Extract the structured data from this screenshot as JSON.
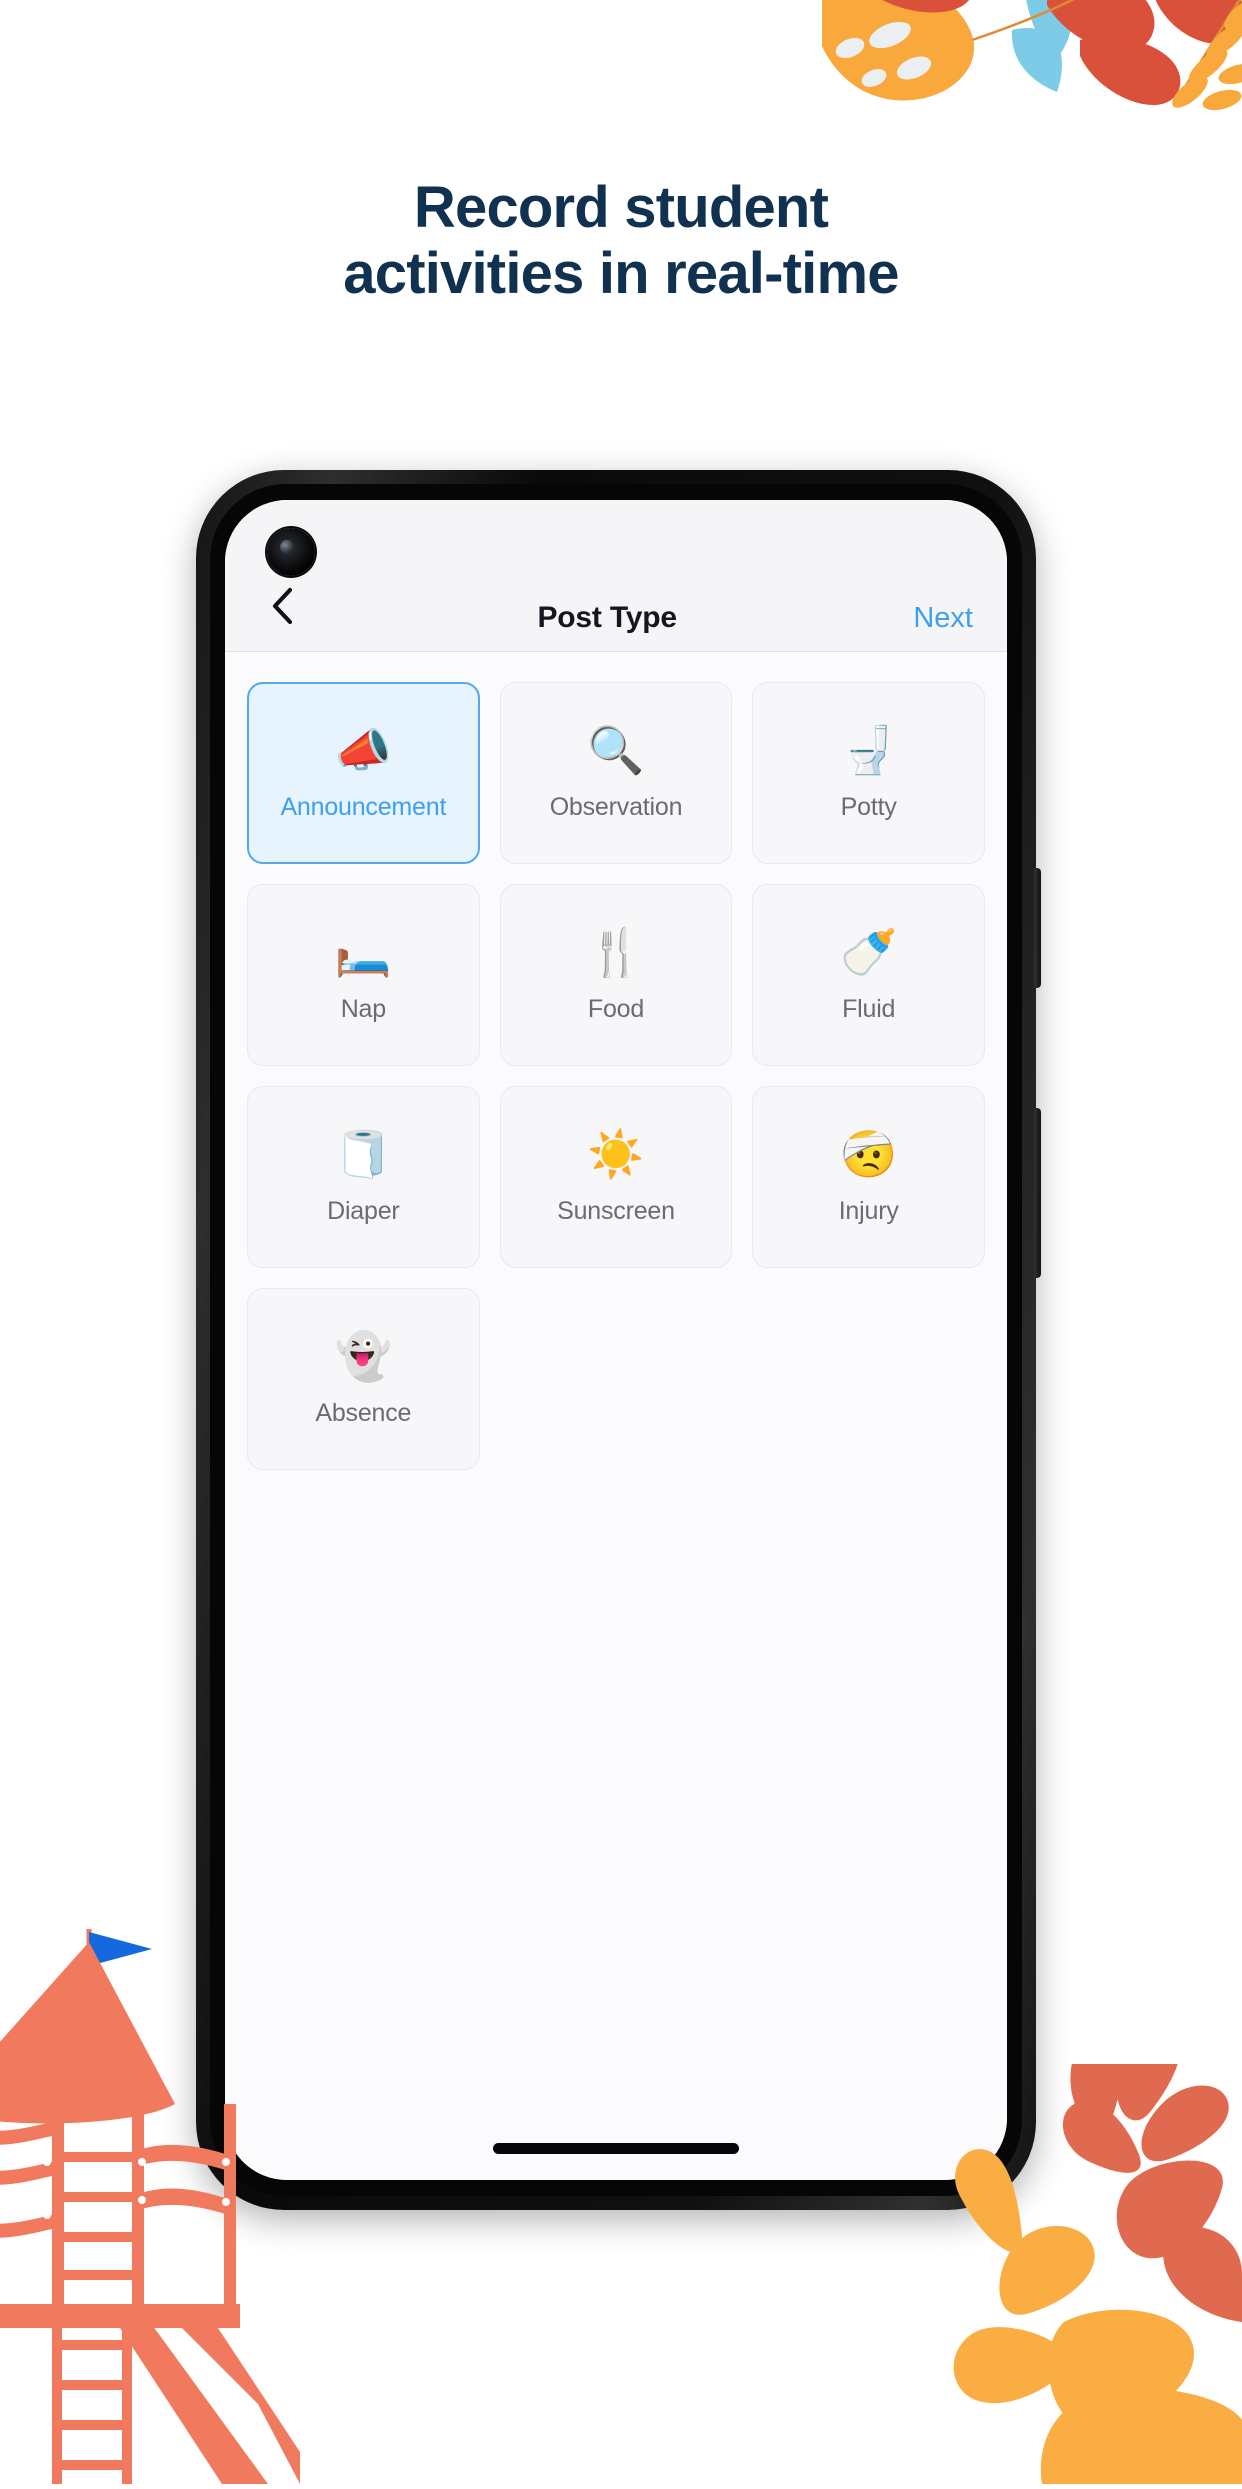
{
  "page": {
    "background_color": "#ffffff",
    "headline_color": "#10314f",
    "headline_line1": "Record student",
    "headline_line2": "activities in real-time"
  },
  "decor": {
    "top_right_name": "tropical-leaves-illustration",
    "bottom_left_name": "playground-illustration",
    "bottom_right_name": "abstract-leaves-illustration",
    "colors": {
      "orange": "#f9a93c",
      "coral": "#e56a52",
      "salmon": "#f0795e",
      "sky_blue": "#7ecbe8",
      "flag_blue": "#1668df",
      "deep_red": "#d9503b"
    }
  },
  "phone": {
    "frame_color": "#0a0a0a",
    "screen_background": "#fbfbfd",
    "camera_name": "front-camera-punch-hole",
    "power_button_name": "power-button",
    "volume_button_name": "volume-rocker",
    "home_indicator_name": "home-indicator"
  },
  "app": {
    "nav": {
      "back_icon": "chevron-left-icon",
      "title": "Post Type",
      "next_label": "Next",
      "next_color": "#3fa0f0",
      "bar_background": "#f5f5f7"
    },
    "grid": {
      "selected_index": 0,
      "selected_bg": "#e7f3fd",
      "selected_border": "#52a9ef",
      "selected_text": "#3fa0f0",
      "unselected_bg": "#f7f7f9",
      "unselected_border": "#e9e9ee",
      "unselected_text": "#6b6b72",
      "tiles": [
        {
          "label": "Announcement",
          "emoji": "📣",
          "icon_name": "megaphone-icon",
          "selected": true
        },
        {
          "label": "Observation",
          "emoji": "🔍",
          "icon_name": "magnifying-glass-icon",
          "selected": false
        },
        {
          "label": "Potty",
          "emoji": "🚽",
          "icon_name": "toilet-icon",
          "selected": false
        },
        {
          "label": "Nap",
          "emoji": "🛏️",
          "icon_name": "bed-icon",
          "selected": false
        },
        {
          "label": "Food",
          "emoji": "🍴",
          "icon_name": "fork-and-knife-icon",
          "selected": false
        },
        {
          "label": "Fluid",
          "emoji": "🍼",
          "icon_name": "baby-bottle-icon",
          "selected": false
        },
        {
          "label": "Diaper",
          "emoji": "🧻",
          "icon_name": "toilet-paper-icon",
          "selected": false
        },
        {
          "label": "Sunscreen",
          "emoji": "☀️",
          "icon_name": "sun-icon",
          "selected": false
        },
        {
          "label": "Injury",
          "emoji": "🤕",
          "icon_name": "head-bandage-icon",
          "selected": false
        },
        {
          "label": "Absence",
          "emoji": "👻",
          "icon_name": "ghost-icon",
          "selected": false
        }
      ]
    }
  }
}
